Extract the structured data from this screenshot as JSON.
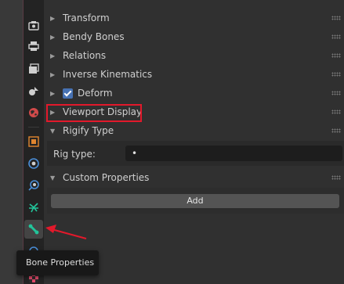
{
  "tabs": [
    {
      "icon": "render-icon"
    },
    {
      "icon": "output-icon"
    },
    {
      "icon": "view-layer-icon"
    },
    {
      "icon": "scene-icon"
    },
    {
      "icon": "world-icon"
    },
    {
      "icon": "object-icon"
    },
    {
      "icon": "modifiers-icon"
    },
    {
      "icon": "physics-icon"
    },
    {
      "icon": "object-data-armature-icon"
    },
    {
      "icon": "bone-icon"
    },
    {
      "icon": "bone-constraint-icon"
    },
    {
      "icon": "material-icon"
    }
  ],
  "panels": {
    "transform": "Transform",
    "bendy_bones": "Bendy Bones",
    "relations": "Relations",
    "inverse_kinematics": "Inverse Kinematics",
    "deform": "Deform",
    "viewport_display": "Viewport Display",
    "rigify_type": "Rigify Type",
    "custom_properties": "Custom Properties"
  },
  "rigify": {
    "rig_type_label": "Rig type:",
    "rig_type_value": "•"
  },
  "custom_properties": {
    "add_label": "Add"
  },
  "tooltip": {
    "text": "Bone Properties"
  },
  "colors": {
    "highlight": "#e2192b",
    "checkbox": "#4772b3",
    "bone_icon": "#22c49a"
  }
}
